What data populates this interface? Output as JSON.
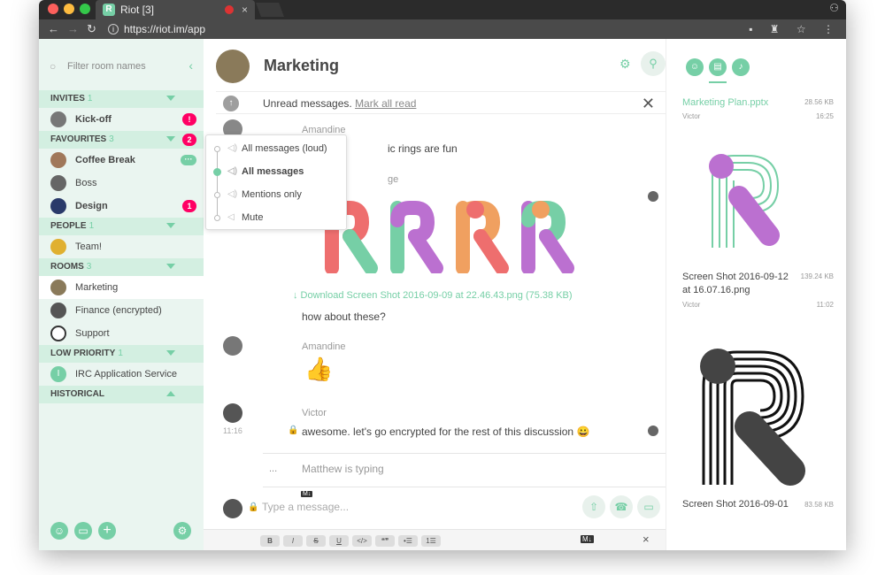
{
  "browser": {
    "tab_title": "Riot [3]",
    "url": "https://riot.im/app",
    "close": "×",
    "tab_logo": "R",
    "nav_back": "←",
    "nav_forward": "→",
    "nav_reload": "↻",
    "info_glyph": "i",
    "toolbar_icons": "▪ ♜ ☆ ⋮",
    "icon_names": [
      "back-arrow-icon",
      "forward-arrow-icon",
      "reload-icon",
      "info-icon",
      "camera-icon",
      "extension-icon",
      "star-icon",
      "more-icon"
    ]
  },
  "accent": "#76cfa6",
  "badge_color": "#ff0064",
  "left": {
    "filter_placeholder": "Filter room names",
    "filter_icons": {
      "search": "○",
      "collapse": "‹"
    },
    "sections": {
      "invites": {
        "label": "INVITES",
        "count": "1"
      },
      "favourites": {
        "label": "FAVOURITES",
        "count": "3",
        "badge": "2"
      },
      "people": {
        "label": "PEOPLE",
        "count": "1"
      },
      "rooms": {
        "label": "ROOMS",
        "count": "3"
      },
      "low_priority": {
        "label": "LOW PRIORITY",
        "count": "1"
      },
      "historical": {
        "label": "HISTORICAL"
      }
    },
    "rooms": {
      "kickoff": {
        "name": "Kick-off",
        "badge": "!"
      },
      "coffee": {
        "name": "Coffee Break",
        "badge": "···"
      },
      "boss": {
        "name": "Boss"
      },
      "design": {
        "name": "Design",
        "badge": "1"
      },
      "team": {
        "name": "Team!"
      },
      "marketing": {
        "name": "Marketing"
      },
      "finance": {
        "name": "Finance (encrypted)"
      },
      "support": {
        "name": "Support"
      },
      "irc": {
        "name": "IRC Application Service",
        "avatar_letter": "I"
      }
    },
    "bottom_buttons": [
      "person-icon",
      "folder-icon",
      "plus-icon",
      "settings-icon"
    ],
    "bottom_glyphs": {
      "person": "☺",
      "folder": "▭",
      "plus": "+",
      "settings": "⚙"
    }
  },
  "notif_menu": {
    "items": [
      "All messages (loud)",
      "All messages",
      "Mentions only",
      "Mute"
    ],
    "selected": "All messages",
    "speaker_glyph": "◁)",
    "mute_glyph": "◁"
  },
  "room": {
    "title": "Marketing",
    "unread_text": "Unread messages.",
    "mark_all_read": "Mark all read",
    "header_glyphs": {
      "settings": "⚙",
      "search": "⚲",
      "close": "✕",
      "jump_up": "↑"
    }
  },
  "timeline": {
    "m1": {
      "sender": "Amandine",
      "text": "ic rings are fun"
    },
    "m2": {
      "sender_partial": "ge"
    },
    "download": "↓ Download Screen Shot 2016-09-09 at 22.46.43.png (75.38 KB)",
    "m3": {
      "text": "how about these?"
    },
    "m4": {
      "sender": "Amandine",
      "text": "👍"
    },
    "m5": {
      "sender": "Victor",
      "time": "11:16",
      "text": "awesome. let's go encrypted for the rest of this discussion 😀"
    },
    "typing": "Matthew is typing",
    "typing_dots": "...",
    "lock_glyph": "🔒"
  },
  "composer": {
    "placeholder": "Type a message...",
    "md_label": "M↓",
    "buttons": [
      "upload-icon",
      "voice-call-icon",
      "video-call-icon"
    ],
    "button_glyphs": {
      "upload": "⇧",
      "voice": "☎",
      "video": "▭"
    },
    "format_buttons": [
      "B",
      "I",
      "S",
      "U",
      "</>",
      "❝❞",
      "•☰",
      "1☰"
    ],
    "close": "×"
  },
  "files": {
    "tab_icons": [
      "members-icon",
      "files-icon",
      "notifications-icon"
    ],
    "tab_glyphs": {
      "members": "☺",
      "files": "▤",
      "notifications": "♪"
    },
    "items": [
      {
        "name": "Marketing Plan.pptx",
        "size": "28.56 KB",
        "sender": "Victor",
        "time": "16:25"
      },
      {
        "name": "Screen Shot 2016-09-12 at 16.07.16.png",
        "size": "139.24 KB",
        "sender": "Victor",
        "time": "11:02"
      },
      {
        "name": "Screen Shot 2016-09-01",
        "size": "83.58 KB"
      }
    ]
  }
}
